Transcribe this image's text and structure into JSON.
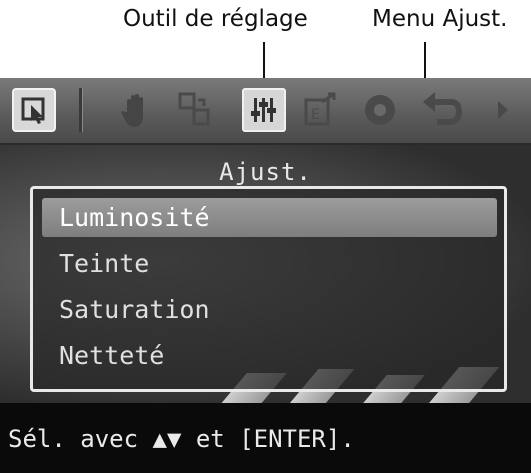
{
  "callouts": {
    "adjust_tool": "Outil de réglage",
    "adjust_menu": "Menu Ajust."
  },
  "toolbar": {
    "icons": [
      "select-icon",
      "hand-icon",
      "rotate-icon",
      "adjust-sliders-icon",
      "export-icon",
      "record-icon",
      "undo-icon",
      "chevron-right-icon"
    ]
  },
  "menu": {
    "title": "Ajust.",
    "items": [
      {
        "label": "Luminosité"
      },
      {
        "label": "Teinte"
      },
      {
        "label": "Saturation"
      },
      {
        "label": "Netteté"
      }
    ],
    "selected_index": 0
  },
  "status": {
    "text": "Sél. avec ▲▼ et [ENTER]."
  },
  "colors": {
    "toolbar": "#6a6a6a",
    "active_tool_bg": "#cfcfcf",
    "menu_border": "#e9e9e9",
    "selected_row": "#8e8e8e",
    "status_bg": "#0a0a0a"
  }
}
